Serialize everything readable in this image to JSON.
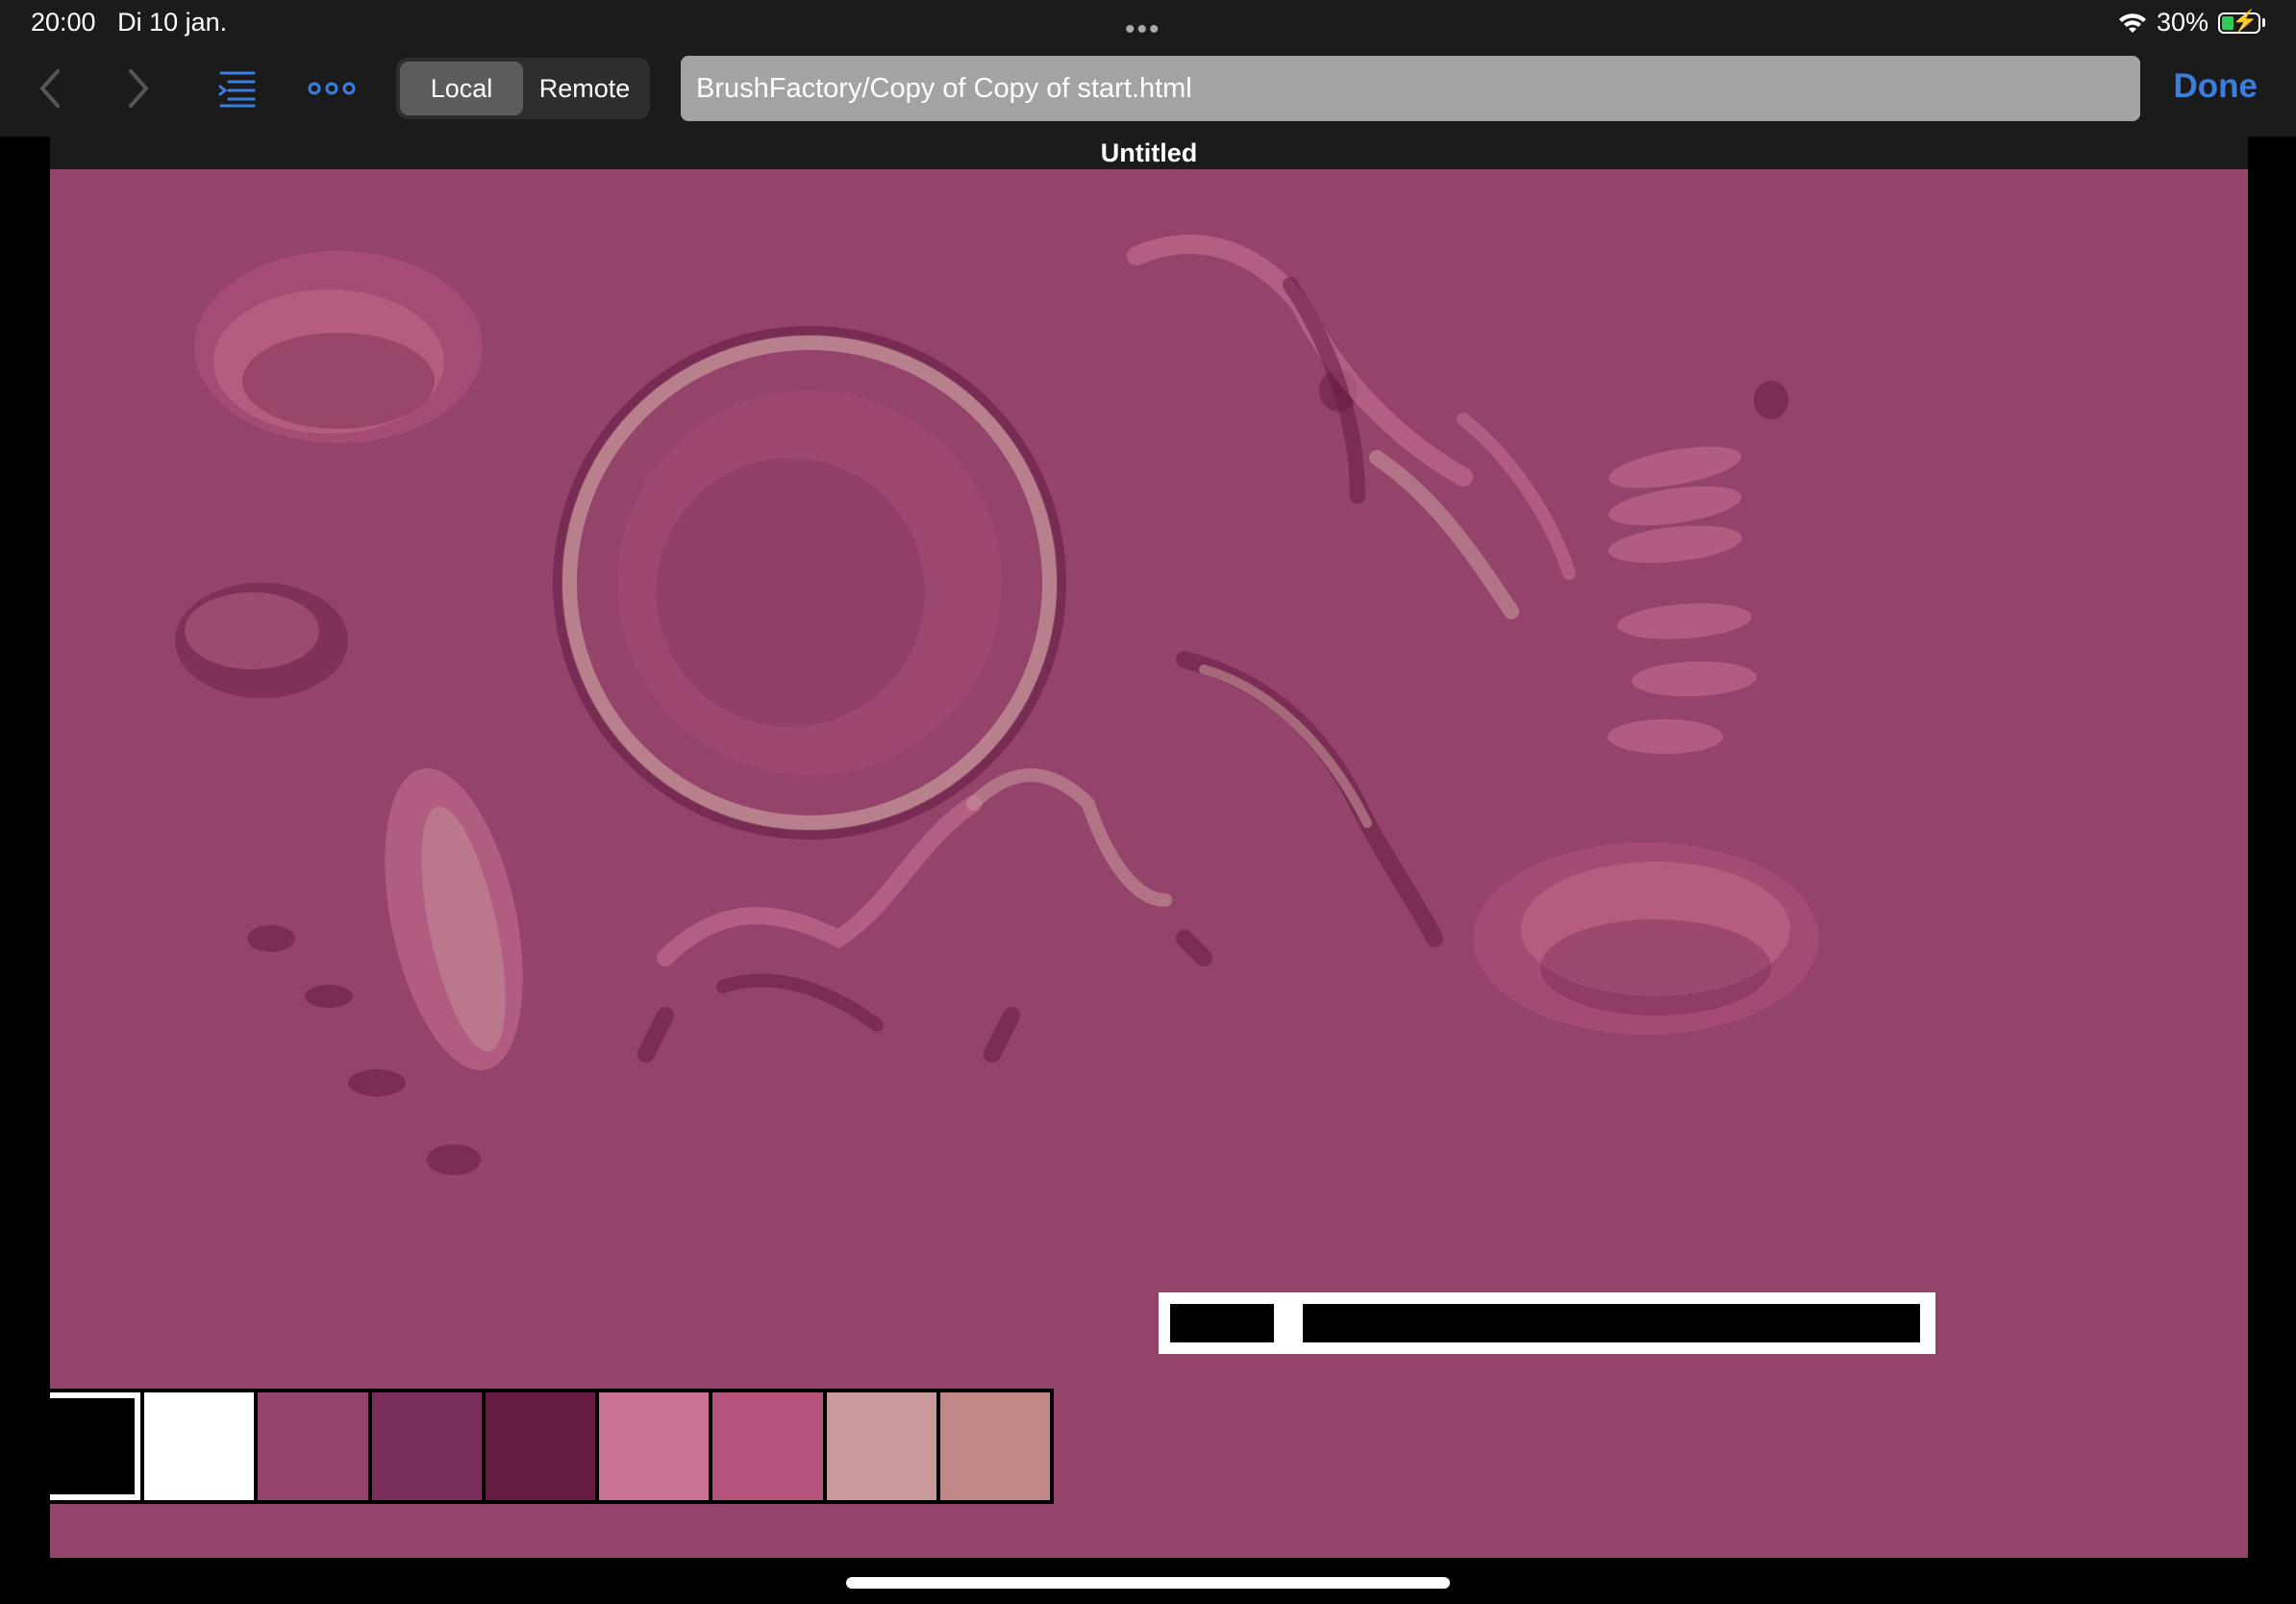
{
  "status": {
    "time": "20:00",
    "date": "Di 10 jan.",
    "battery": "30%",
    "battery_level": 0.3
  },
  "toolbar": {
    "back_icon": "chevron-left-icon",
    "forward_icon": "chevron-right-icon",
    "outline_icon": "outline-list-icon",
    "more_icon": "more-dots-icon",
    "segments": [
      "Local",
      "Remote"
    ],
    "active_segment": "Local",
    "url": "BrushFactory/Copy of Copy of start.html",
    "done_label": "Done"
  },
  "document": {
    "title": "Untitled"
  },
  "colors": {
    "canvas_bg": "#94436b",
    "accent": "#3a7ee0"
  },
  "palette": [
    "#000000",
    "#ffffff",
    "#94436b",
    "#7a2e5a",
    "#661c43",
    "#c97192",
    "#b3537b",
    "#c89a9a",
    "#bf8786"
  ],
  "selected_swatch": 0,
  "progress_bar": {
    "segments": 2
  }
}
